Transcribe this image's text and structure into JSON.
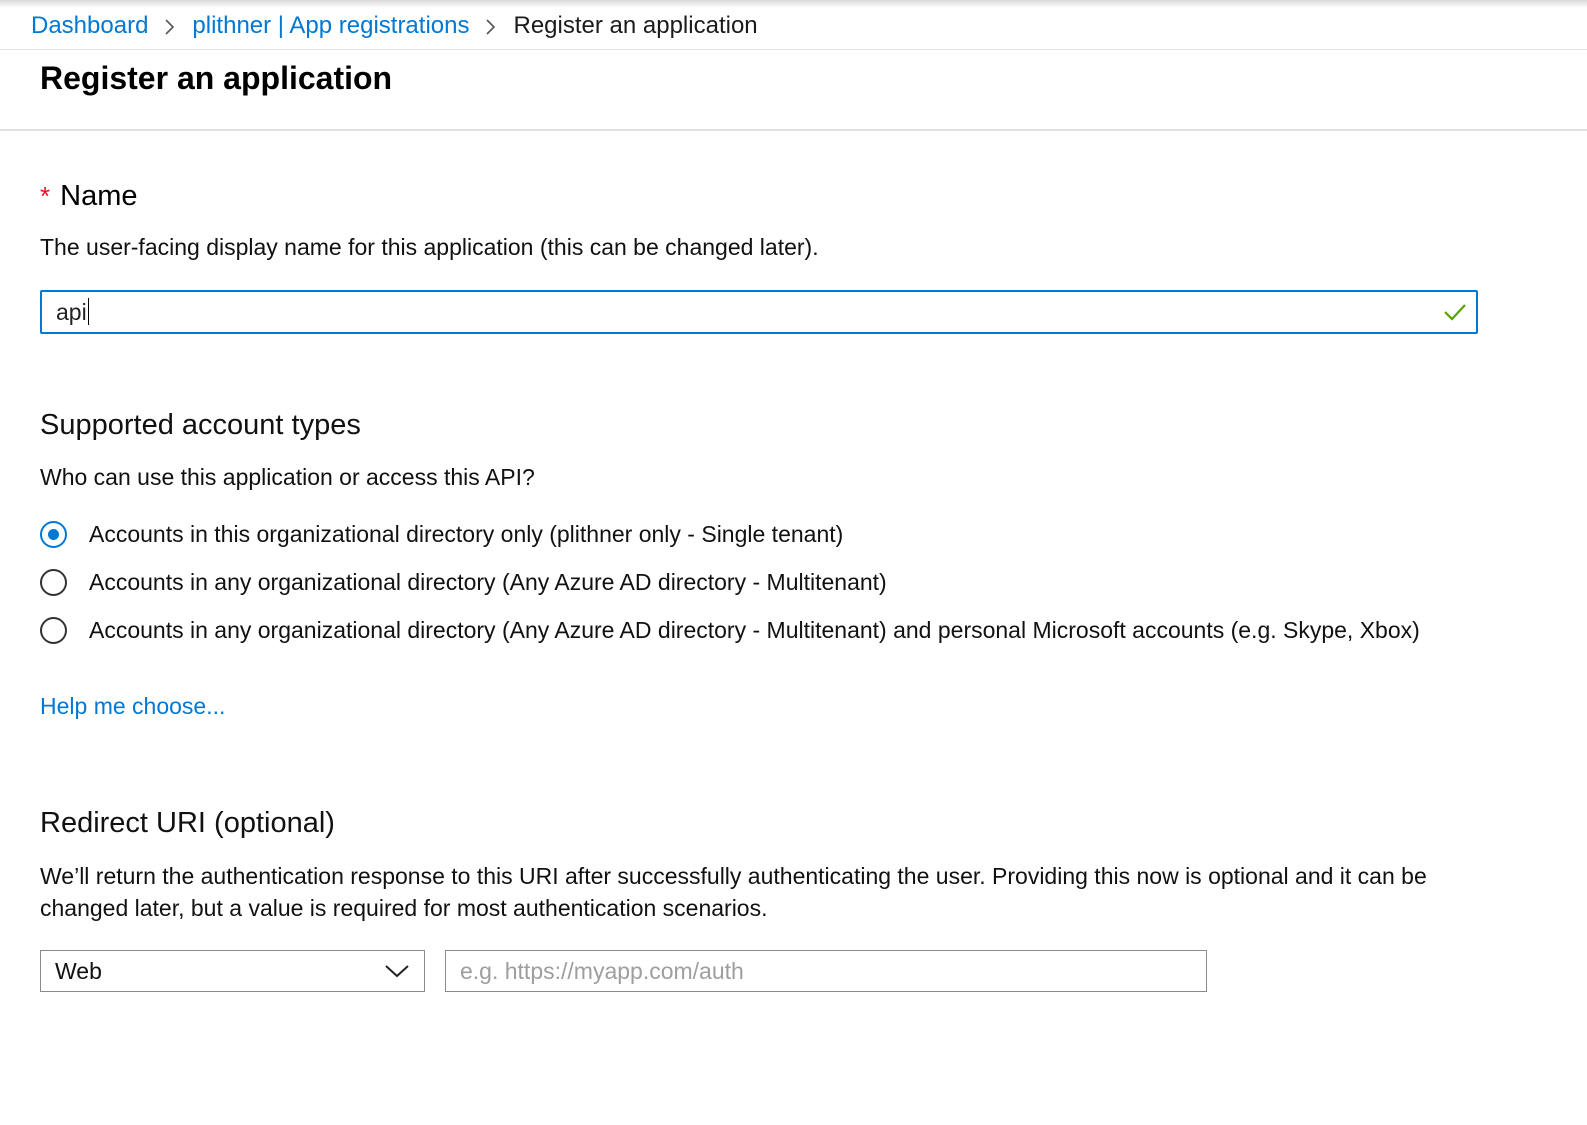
{
  "breadcrumb": {
    "items": [
      "Dashboard",
      "plithner | App registrations"
    ],
    "current": "Register an application"
  },
  "page": {
    "title": "Register an application"
  },
  "name_section": {
    "required_marker": "*",
    "label": "Name",
    "description": "The user-facing display name for this application (this can be changed later).",
    "value": "api",
    "valid_icon": "checkmark-icon"
  },
  "account_types": {
    "heading": "Supported account types",
    "question": "Who can use this application or access this API?",
    "options": [
      {
        "label": "Accounts in this organizational directory only (plithner only - Single tenant)",
        "selected": true
      },
      {
        "label": "Accounts in any organizational directory (Any Azure AD directory - Multitenant)",
        "selected": false
      },
      {
        "label": "Accounts in any organizational directory (Any Azure AD directory - Multitenant) and personal Microsoft accounts (e.g. Skype, Xbox)",
        "selected": false
      }
    ],
    "help_link": "Help me choose..."
  },
  "redirect": {
    "heading": "Redirect URI (optional)",
    "description": "We’ll return the authentication response to this URI after successfully authenticating the user. Providing this now is optional and it can be changed later, but a value is required for most authentication scenarios.",
    "platform_value": "Web",
    "uri_placeholder": "e.g. https://myapp.com/auth"
  },
  "colors": {
    "accent": "#0078d4",
    "required": "#e81123",
    "valid": "#57a300"
  }
}
